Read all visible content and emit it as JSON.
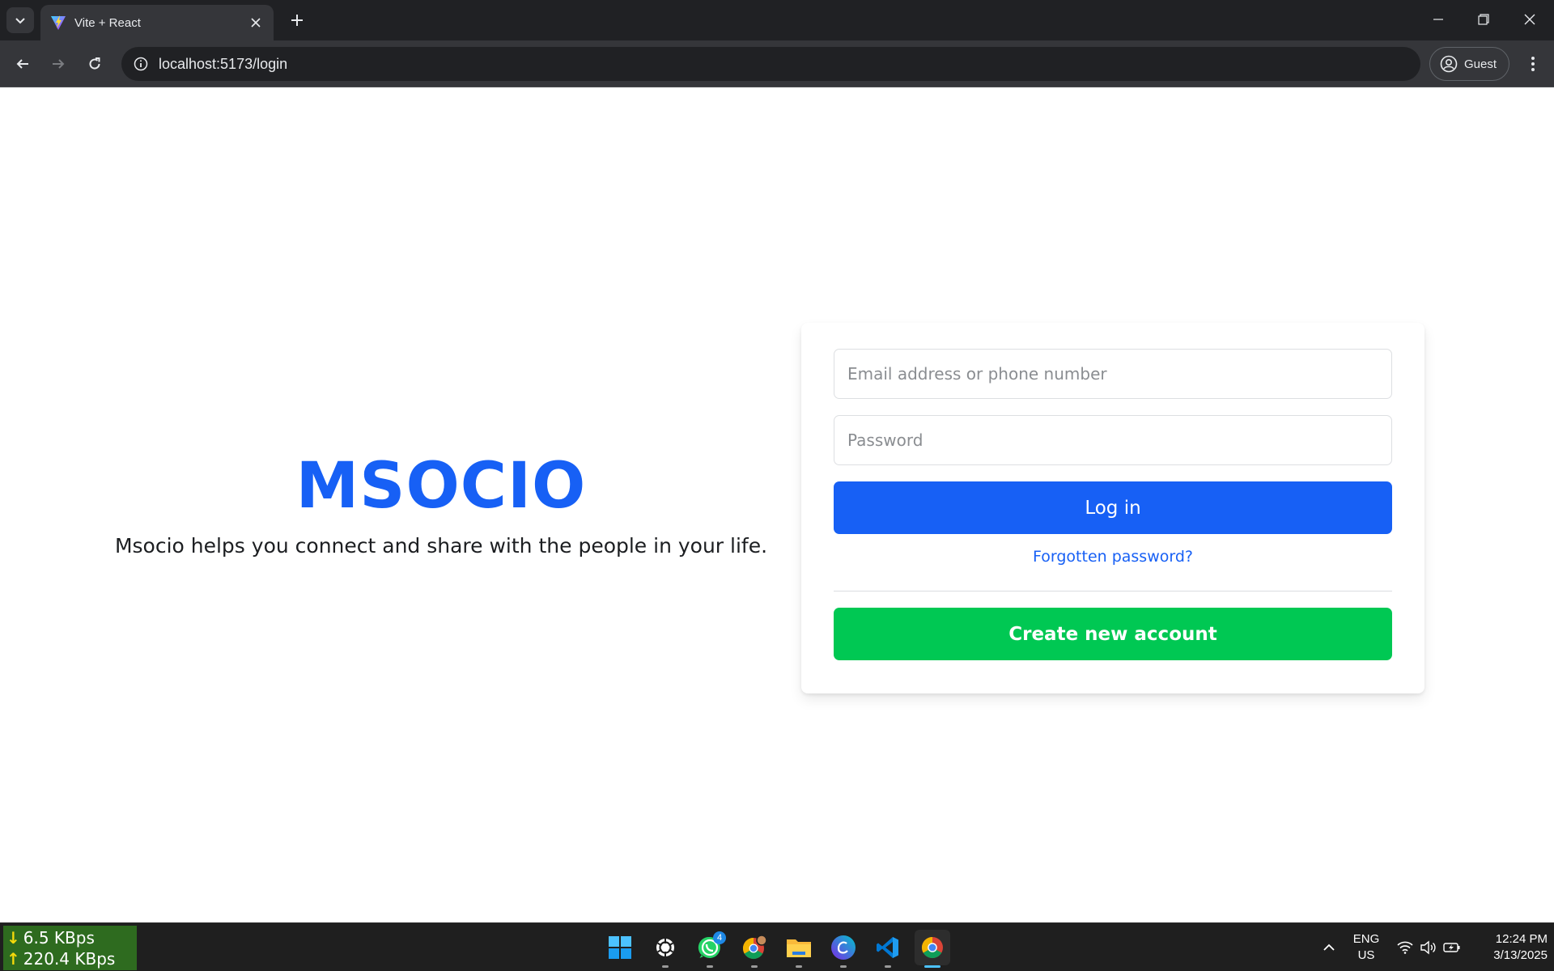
{
  "browser": {
    "tab_title": "Vite + React",
    "url": "localhost:5173/login",
    "profile_label": "Guest"
  },
  "page": {
    "brand": "MSOCIO",
    "tagline": "Msocio helps you connect and share with the people in your life.",
    "email_placeholder": "Email address or phone number",
    "password_placeholder": "Password",
    "login_label": "Log in",
    "forgot_label": "Forgotten password?",
    "create_label": "Create new account",
    "colors": {
      "primary": "#1760f5",
      "create": "#00c853"
    }
  },
  "taskbar": {
    "net_down": "6.5 KBps",
    "net_up": "220.4 KBps",
    "whatsapp_badge": "4",
    "lang_line1": "ENG",
    "lang_line2": "US",
    "time": "12:24 PM",
    "date": "3/13/2025",
    "apps": [
      "start-icon",
      "chatgpt-icon",
      "whatsapp-icon",
      "chrome-profile-icon",
      "file-explorer-icon",
      "canva-icon",
      "vscode-icon",
      "chrome-icon"
    ]
  }
}
